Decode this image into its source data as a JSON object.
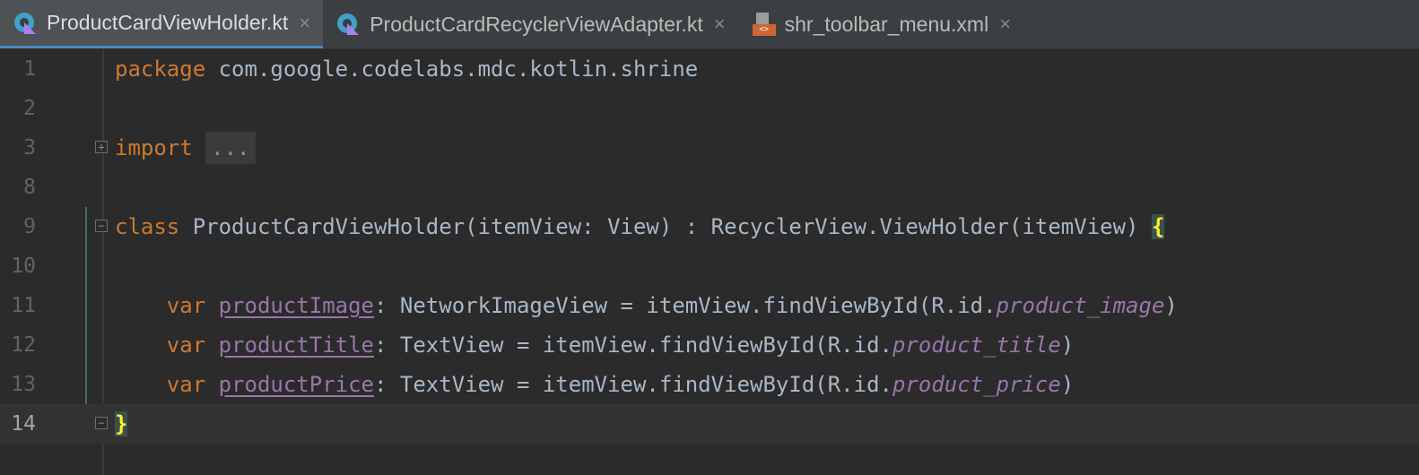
{
  "tabs": [
    {
      "label": "ProductCardViewHolder.kt",
      "icon": "kotlin-file-icon",
      "active": true
    },
    {
      "label": "ProductCardRecyclerViewAdapter.kt",
      "icon": "kotlin-file-icon",
      "active": false
    },
    {
      "label": "shr_toolbar_menu.xml",
      "icon": "xml-file-icon",
      "active": false
    }
  ],
  "close_glyph": "×",
  "editor": {
    "line_numbers": [
      "1",
      "2",
      "3",
      "8",
      "9",
      "10",
      "11",
      "12",
      "13",
      "14"
    ],
    "line1": {
      "kw": "package",
      "rest": " com.google.codelabs.mdc.kotlin.shrine"
    },
    "line3": {
      "kw": "import",
      "folded": "..."
    },
    "line9": {
      "kw": "class",
      "rest": " ProductCardViewHolder(itemView: View) : RecyclerView.ViewHolder(itemView) ",
      "brace": "{"
    },
    "line11": {
      "indent": "    ",
      "kw": "var",
      "prop": "productImage",
      "rest": ": NetworkImageView = itemView.findViewById(R.id.",
      "idref": "product_image",
      "close": ")"
    },
    "line12": {
      "indent": "    ",
      "kw": "var",
      "prop": "productTitle",
      "rest": ": TextView = itemView.findViewById(R.id.",
      "idref": "product_title",
      "close": ")"
    },
    "line13": {
      "indent": "    ",
      "kw": "var",
      "prop": "productPrice",
      "rest": ": TextView = itemView.findViewById(R.id.",
      "idref": "product_price",
      "close": ")"
    },
    "line14": {
      "brace": "}"
    },
    "fold_expand_glyph": "+",
    "fold_collapse_glyph": "−"
  },
  "colors": {
    "background": "#2b2b2b",
    "keyword": "#cc7832",
    "text": "#a9b7c6",
    "property": "#9876aa",
    "brace_highlight": "#ffef28"
  }
}
